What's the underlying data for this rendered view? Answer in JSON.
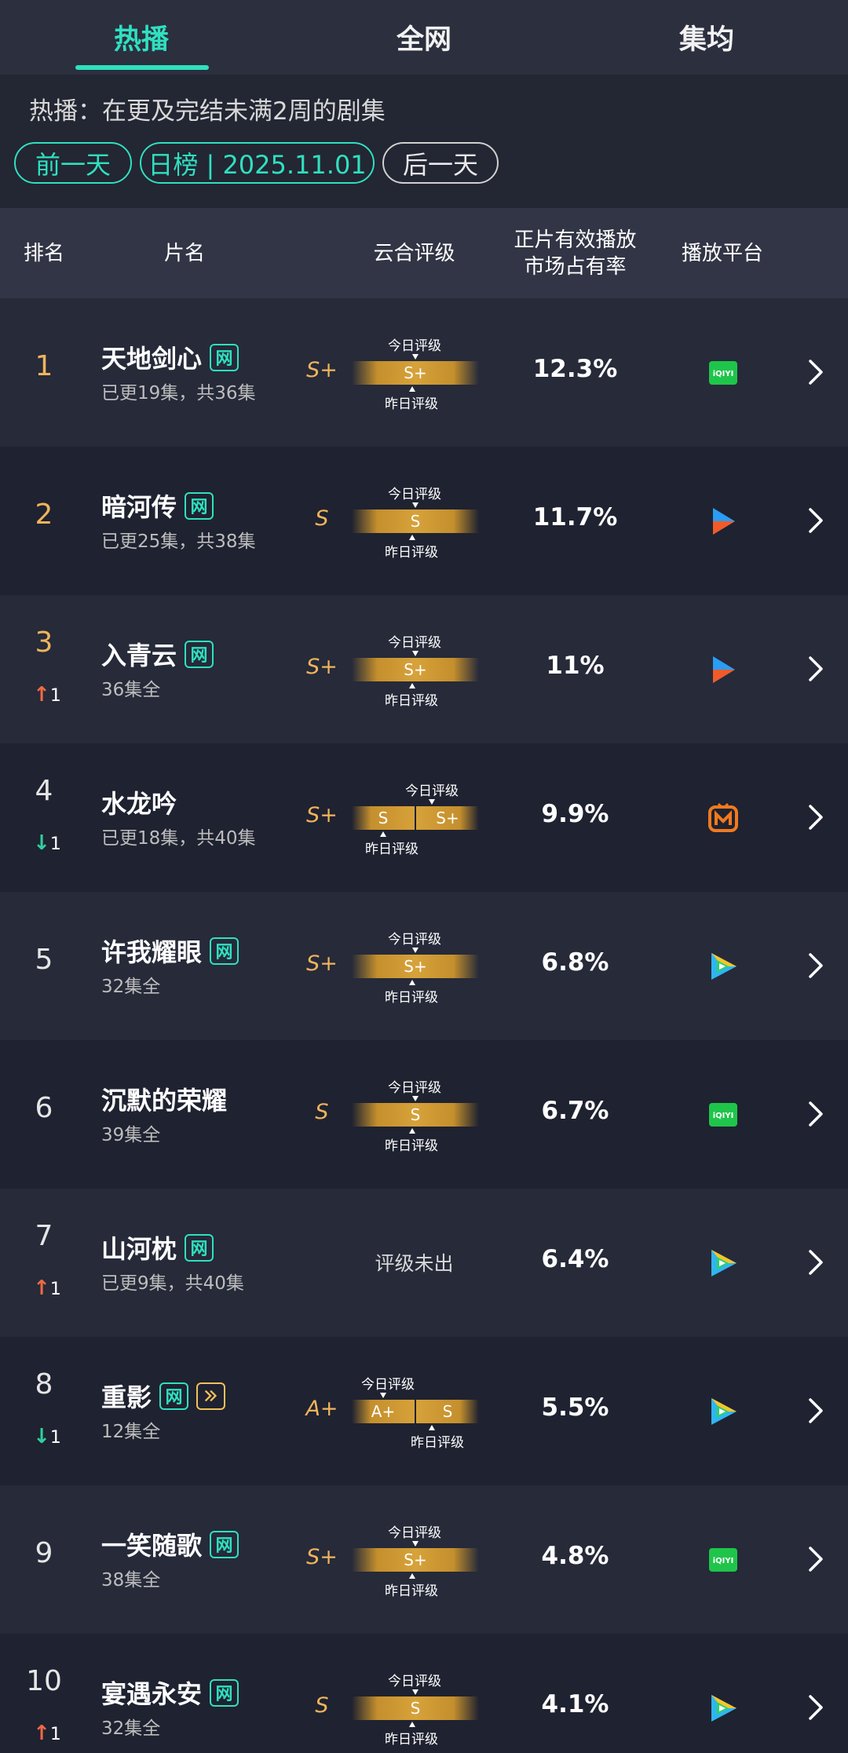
{
  "tabs": [
    {
      "label": "热播",
      "active": true
    },
    {
      "label": "全网",
      "active": false
    },
    {
      "label": "集均",
      "active": false
    }
  ],
  "info": {
    "description": "热播：在更及完结未满2周的剧集",
    "prev_day": "前一天",
    "date_label": "日榜 | 2025.11.01",
    "next_day": "后一天"
  },
  "columns": {
    "rank": "排名",
    "title": "片名",
    "rating": "云合评级",
    "share_line1": "正片有效播放",
    "share_line2": "市场占有率",
    "platform": "播放平台"
  },
  "grade_labels": {
    "today": "今日评级",
    "yesterday": "昨日评级"
  },
  "colors": {
    "accent": "#2fe0c0",
    "gold": "#f0b45c",
    "up": "#f06a43",
    "down": "#2fd0a0",
    "exclusive": "#f2c25a"
  },
  "rows": [
    {
      "rank": "1",
      "change_dir": "",
      "change": "",
      "title": "天地剑心",
      "badge": "网",
      "badge2": "",
      "episodes": "已更19集，共36集",
      "grade": "S+",
      "today": "S+",
      "yesterday": "",
      "no_grade": "",
      "share": "12.3%",
      "platform": "iqiyi-icon"
    },
    {
      "rank": "2",
      "change_dir": "",
      "change": "",
      "title": "暗河传",
      "badge": "网",
      "badge2": "",
      "episodes": "已更25集，共38集",
      "grade": "S",
      "today": "S",
      "yesterday": "",
      "no_grade": "",
      "share": "11.7%",
      "platform": "youku-icon"
    },
    {
      "rank": "3",
      "change_dir": "up",
      "change": "1",
      "title": "入青云",
      "badge": "网",
      "badge2": "",
      "episodes": "36集全",
      "grade": "S+",
      "today": "S+",
      "yesterday": "",
      "no_grade": "",
      "share": "11%",
      "platform": "youku-icon"
    },
    {
      "rank": "4",
      "change_dir": "down",
      "change": "1",
      "title": "水龙吟",
      "badge": "",
      "badge2": "",
      "episodes": "已更18集，共40集",
      "grade": "S+",
      "today": "S+",
      "yesterday": "S",
      "no_grade": "",
      "share": "9.9%",
      "platform": "mgtv-icon"
    },
    {
      "rank": "5",
      "change_dir": "",
      "change": "",
      "title": "许我耀眼",
      "badge": "网",
      "badge2": "",
      "episodes": "32集全",
      "grade": "S+",
      "today": "S+",
      "yesterday": "",
      "no_grade": "",
      "share": "6.8%",
      "platform": "tencent-video-icon"
    },
    {
      "rank": "6",
      "change_dir": "",
      "change": "",
      "title": "沉默的荣耀",
      "badge": "",
      "badge2": "",
      "episodes": "39集全",
      "grade": "S",
      "today": "S",
      "yesterday": "",
      "no_grade": "",
      "share": "6.7%",
      "platform": "iqiyi-icon"
    },
    {
      "rank": "7",
      "change_dir": "up",
      "change": "1",
      "title": "山河枕",
      "badge": "网",
      "badge2": "",
      "episodes": "已更9集，共40集",
      "grade": "",
      "today": "",
      "yesterday": "",
      "no_grade": "评级未出",
      "share": "6.4%",
      "platform": "tencent-video-icon"
    },
    {
      "rank": "8",
      "change_dir": "down",
      "change": "1",
      "title": "重影",
      "badge": "网",
      "badge2": "exclusive",
      "episodes": "12集全",
      "grade": "A+",
      "today": "A+",
      "yesterday": "S",
      "no_grade": "",
      "share": "5.5%",
      "platform": "tencent-video-icon"
    },
    {
      "rank": "9",
      "change_dir": "",
      "change": "",
      "title": "一笑随歌",
      "badge": "网",
      "badge2": "",
      "episodes": "38集全",
      "grade": "S+",
      "today": "S+",
      "yesterday": "",
      "no_grade": "",
      "share": "4.8%",
      "platform": "iqiyi-icon"
    },
    {
      "rank": "10",
      "change_dir": "up",
      "change": "1",
      "title": "宴遇永安",
      "badge": "网",
      "badge2": "",
      "episodes": "32集全",
      "grade": "S",
      "today": "S",
      "yesterday": "",
      "no_grade": "",
      "share": "4.1%",
      "platform": "tencent-video-icon"
    }
  ]
}
